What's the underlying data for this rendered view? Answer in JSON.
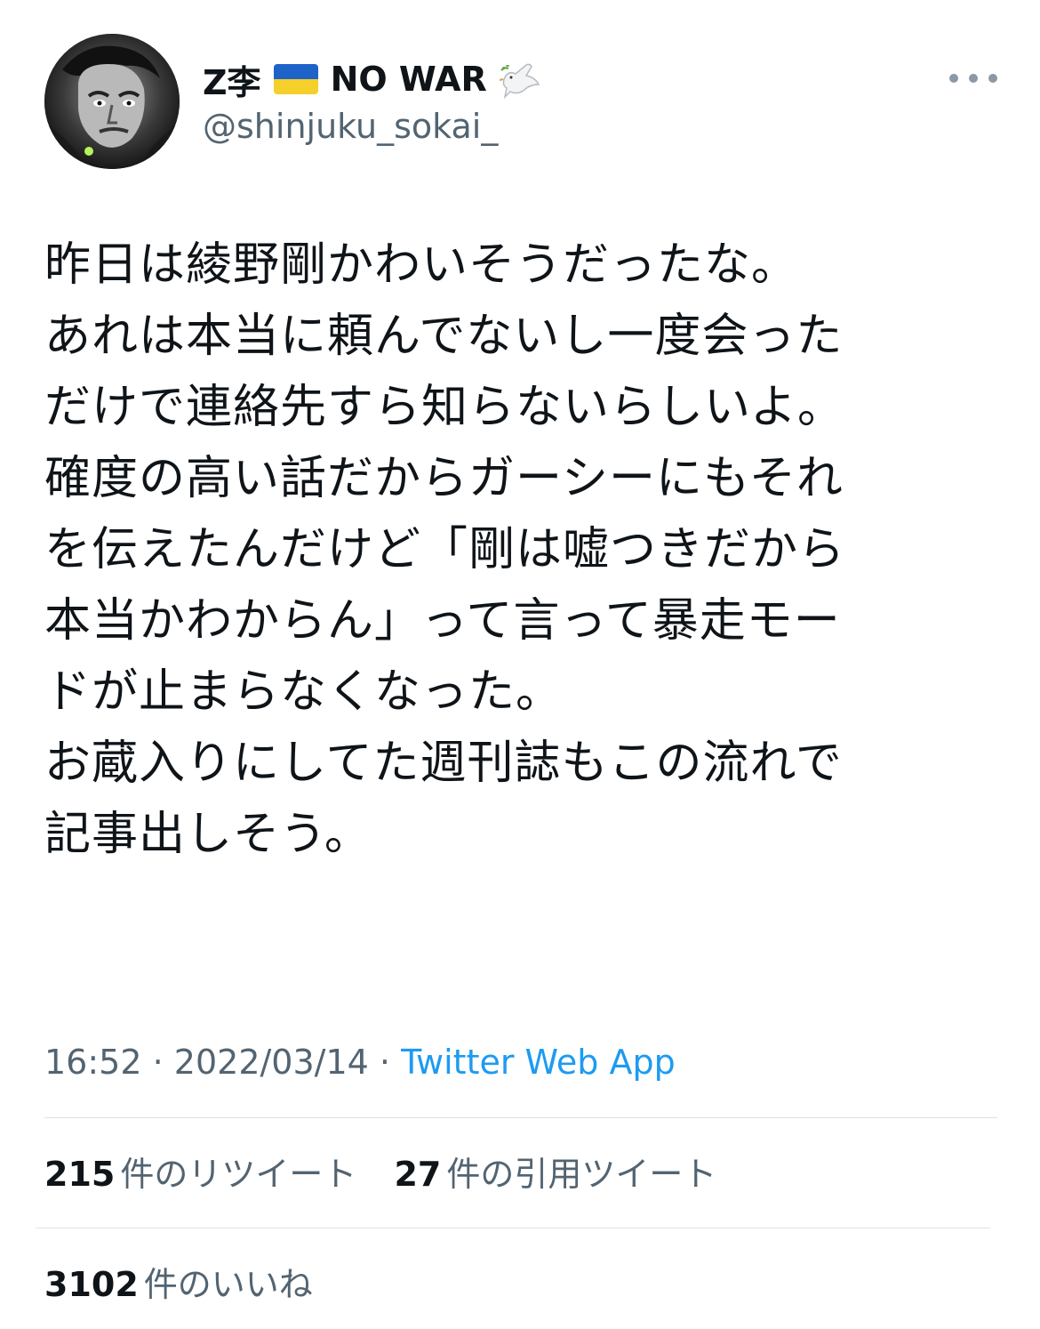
{
  "user": {
    "name": "Z李",
    "flag_icon": "ukraine-flag-icon",
    "name_suffix": "NO WAR",
    "dove_icon": "dove-icon",
    "handle": "@shinjuku_sokai_"
  },
  "tweet": {
    "lines": [
      "昨日は綾野剛かわいそうだったな。",
      "あれは本当に頼んでないし一度会った",
      "だけで連絡先すら知らないらしいよ。",
      "確度の高い話だからガーシーにもそれ",
      "を伝えたんだけど「剛は嘘つきだから",
      "本当かわからん」って言って暴走モー",
      "ドが止まらなくなった。",
      "お蔵入りにしてた週刊誌もこの流れで",
      "記事出しそう。"
    ],
    "time": "16:52",
    "separator": "·",
    "date": "2022/03/14",
    "source": "Twitter Web App"
  },
  "stats": {
    "retweets": {
      "count": "215",
      "label": "件のリツイート"
    },
    "quotes": {
      "count": "27",
      "label": "件の引用ツイート"
    },
    "likes": {
      "count": "3102",
      "label": "件のいいね"
    }
  },
  "colors": {
    "text": "#0f1419",
    "secondary": "#536471",
    "link": "#1d9bf0",
    "divider": "#dfe3e6"
  }
}
